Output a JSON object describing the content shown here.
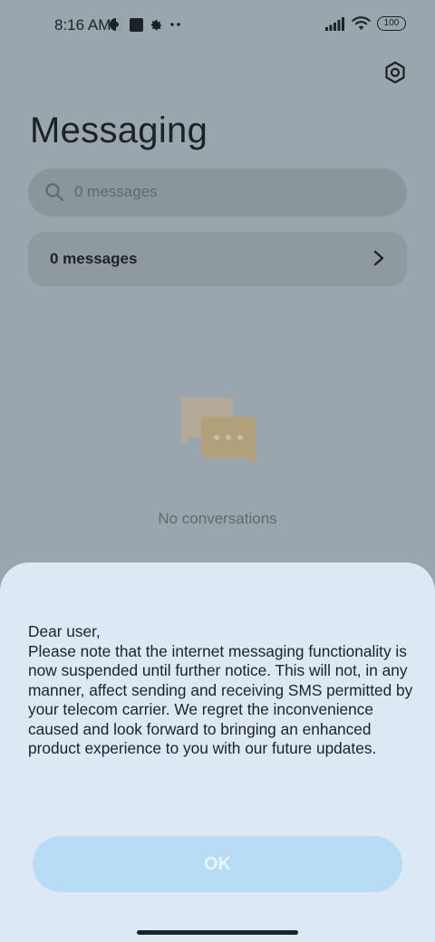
{
  "status_bar": {
    "time": "8:16 AM",
    "left_icons": [
      "vpn-key-icon",
      "app-notification-icon",
      "settings-gear-icon",
      "more-dots-icon"
    ],
    "right_icons": [
      "signal-icon",
      "wifi-icon",
      "battery-icon"
    ],
    "battery_level": "100"
  },
  "header": {
    "title": "Messaging",
    "settings_icon": "settings-hexagon-icon"
  },
  "search": {
    "placeholder": "0 messages",
    "icon": "search-icon"
  },
  "messages_row": {
    "label": "0 messages",
    "icon": "chevron-right-icon"
  },
  "empty_state": {
    "icon": "chat-bubbles-icon",
    "text": "No conversations"
  },
  "dialog": {
    "body": "Dear user,\nPlease note that the internet messaging functionality is now suspended until further notice. This will not, in any manner, affect sending and receiving SMS permitted by your telecom carrier. We regret the inconvenience caused and look forward to bringing an enhanced product experience to you with our future updates.",
    "ok_label": "OK"
  },
  "colors": {
    "dimmed_background": "#9aa6ad",
    "dialog_background": "#dce8f3",
    "ok_button": "#b8dbf6"
  }
}
